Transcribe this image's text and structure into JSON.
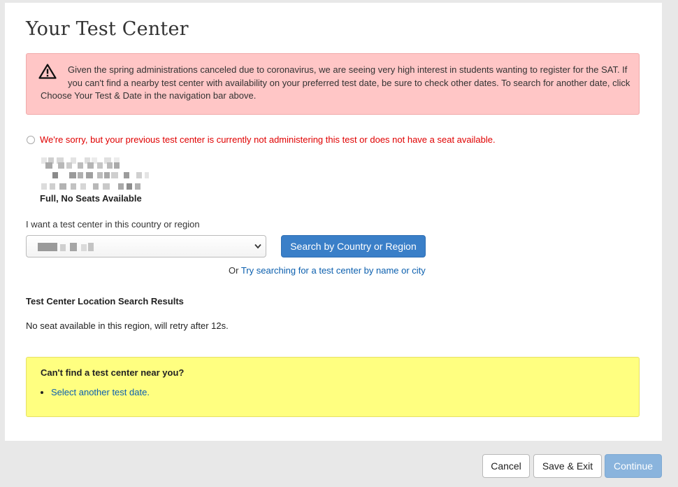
{
  "page": {
    "title": "Your Test Center"
  },
  "notice": {
    "icon": "warning-icon",
    "text": "Given the spring administrations canceled due to coronavirus, we are seeing very high interest in students wanting to register for the SAT. If you can't find a nearby test center with availability on your preferred test date, be sure to check other dates. To search for another date, click Choose Your Test & Date in the navigation bar above."
  },
  "previous_center": {
    "message": "We're sorry, but your previous test center is currently not administering this test or does not have a seat available.",
    "status": "Full, No Seats Available"
  },
  "search": {
    "label": "I want a test center in this country or region",
    "button_label": "Search by Country or Region",
    "or_prefix": "Or ",
    "alt_link": "Try searching for a test center by name or city"
  },
  "results": {
    "heading": "Test Center Location Search Results",
    "message": "No seat available in this region, will retry after 12s."
  },
  "help": {
    "heading": "Can't find a test center near you?",
    "items": [
      "Select another test date."
    ]
  },
  "footer": {
    "cancel": "Cancel",
    "save_exit": "Save & Exit",
    "continue": "Continue"
  },
  "colors": {
    "primary": "#3a7fc8",
    "danger_bg": "#ffc6c6",
    "error_text": "#e00000",
    "warn_bg": "#ffff80",
    "link": "#0b5fae"
  }
}
